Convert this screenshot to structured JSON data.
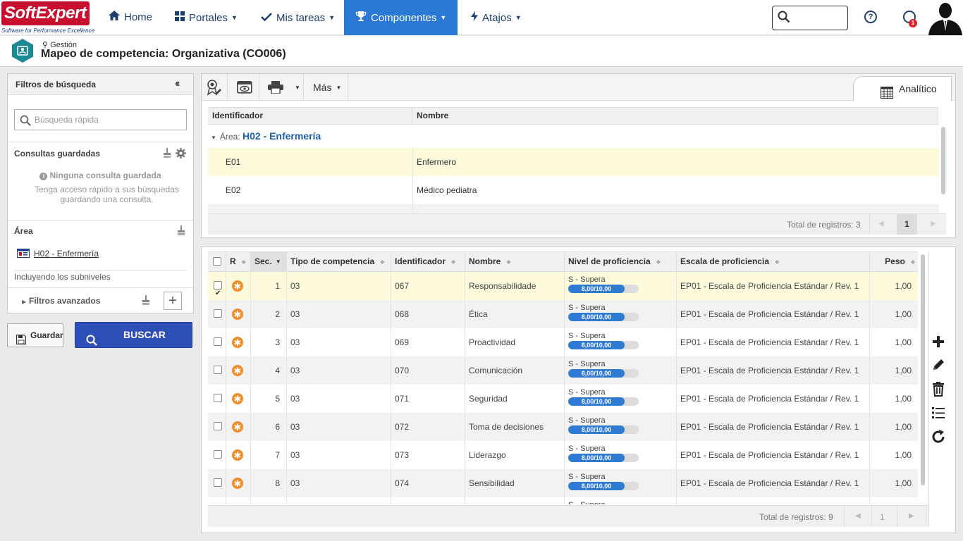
{
  "brand": {
    "name_a": "Soft",
    "name_b": "Expert",
    "tagline": "Software for Performance Excellence"
  },
  "nav": {
    "home": "Home",
    "portales": "Portales",
    "tareas": "Mis tareas",
    "componentes": "Componentes",
    "atajos": "Atajos",
    "notifications_count": "1",
    "help_glyph": "?"
  },
  "page": {
    "breadcrumb": "Gestión",
    "title": "Mapeo de competencia: Organizativa (CO006)"
  },
  "filters": {
    "title": "Filtros de búsqueda",
    "quick_search_placeholder": "Búsqueda rápida",
    "saved_title": "Consultas guardadas",
    "saved_none": "Ninguna consulta guardada",
    "saved_desc": "Tenga acceso rápido a sus búsquedas guardando una consulta.",
    "area_title": "Área",
    "area_value": "H02 - Enfermería",
    "area_sub": "Incluyendo los subniveles",
    "advanced": "Filtros avanzados",
    "save_button": "Guardar",
    "search_button": "BUSCAR"
  },
  "upper_grid": {
    "toolbar_more": "Más",
    "tab_label": "Analítico",
    "columns": [
      "Identificador",
      "Nombre"
    ],
    "group_prefix": "Área:",
    "group_name": "H02 - Enfermería",
    "rows": [
      {
        "id": "E01",
        "name": "Enfermero"
      },
      {
        "id": "E02",
        "name": "Médico pediatra"
      }
    ],
    "total": "Total de registros: 3",
    "page": "1"
  },
  "lower_grid": {
    "columns": {
      "r": "R",
      "seq": "Sec.",
      "type": "Tipo de competencia",
      "id": "Identificador",
      "name": "Nombre",
      "level": "Nivel de proficiencia",
      "scale": "Escala de proficiencia",
      "weight": "Peso"
    },
    "rows": [
      {
        "seq": "1",
        "type": "03",
        "id": "067",
        "name": "Responsabilidade",
        "level": "S - Supera",
        "score": "8,00/10,00",
        "progress": 0.8,
        "scale": "EP01 - Escala de Proficiencia Estándar / Rev. 1",
        "weight": "1,00",
        "checked": true
      },
      {
        "seq": "2",
        "type": "03",
        "id": "068",
        "name": "Ética",
        "level": "S - Supera",
        "score": "8,00/10,00",
        "progress": 0.8,
        "scale": "EP01 - Escala de Proficiencia Estándar / Rev. 1",
        "weight": "1,00",
        "checked": false
      },
      {
        "seq": "3",
        "type": "03",
        "id": "069",
        "name": "Proactividad",
        "level": "S - Supera",
        "score": "8,00/10,00",
        "progress": 0.8,
        "scale": "EP01 - Escala de Proficiencia Estándar / Rev. 1",
        "weight": "1,00",
        "checked": false
      },
      {
        "seq": "4",
        "type": "03",
        "id": "070",
        "name": "Comunicación",
        "level": "S - Supera",
        "score": "8,00/10,00",
        "progress": 0.8,
        "scale": "EP01 - Escala de Proficiencia Estándar / Rev. 1",
        "weight": "1,00",
        "checked": false
      },
      {
        "seq": "5",
        "type": "03",
        "id": "071",
        "name": "Seguridad",
        "level": "S - Supera",
        "score": "8,00/10,00",
        "progress": 0.8,
        "scale": "EP01 - Escala de Proficiencia Estándar / Rev. 1",
        "weight": "1,00",
        "checked": false
      },
      {
        "seq": "6",
        "type": "03",
        "id": "072",
        "name": "Toma de decisiones",
        "level": "S - Supera",
        "score": "8,00/10,00",
        "progress": 0.8,
        "scale": "EP01 - Escala de Proficiencia Estándar / Rev. 1",
        "weight": "1,00",
        "checked": false
      },
      {
        "seq": "7",
        "type": "03",
        "id": "073",
        "name": "Liderazgo",
        "level": "S - Supera",
        "score": "8,00/10,00",
        "progress": 0.8,
        "scale": "EP01 - Escala de Proficiencia Estándar / Rev. 1",
        "weight": "1,00",
        "checked": false
      },
      {
        "seq": "8",
        "type": "03",
        "id": "074",
        "name": "Sensibilidad",
        "level": "S - Supera",
        "score": "8,00/10,00",
        "progress": 0.8,
        "scale": "EP01 - Escala de Proficiencia Estándar / Rev. 1",
        "weight": "1,00",
        "checked": false
      },
      {
        "seq": "",
        "type": "",
        "id": "",
        "name": "",
        "level": "S - Supera",
        "score": "",
        "progress": 0,
        "scale": "",
        "weight": "",
        "checked": false
      }
    ],
    "total": "Total de registros: 9",
    "page": "1"
  },
  "colors": {
    "accent": "#2a7ad5",
    "brand": "#c8102e",
    "search_button": "#2e4fb8",
    "highlight_row": "#fdfbdc",
    "r_icon": "#f28c28"
  }
}
